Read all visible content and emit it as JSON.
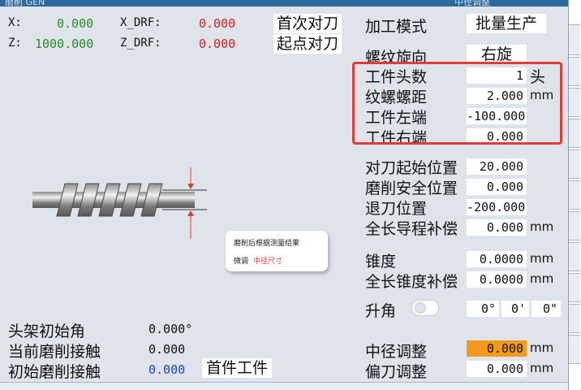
{
  "title_left": "磨削 GEN",
  "title_right": "中径调整",
  "coords": {
    "x_label": "X:",
    "x_value": "0.000",
    "z_label": "Z:",
    "z_value": "1000.000",
    "xdrf_label": "X_DRF:",
    "xdrf_value": "0.000",
    "zdrf_label": "Z_DRF:",
    "zdrf_value": "0.000"
  },
  "buttons": {
    "first_tool_set": "首次对刀",
    "start_tool_set": "起点对刀"
  },
  "machining_mode": {
    "label": "加工模式",
    "value": "批量生产"
  },
  "thread_direction": {
    "label": "螺纹旋向",
    "value": "右旋"
  },
  "workpiece": {
    "heads_label": "工件头数",
    "heads_value": "1",
    "heads_unit": "头",
    "pitch_label": "纹螺螺距",
    "pitch_value": "2.000",
    "pitch_unit": "mm",
    "left_label": "工件左端",
    "left_value": "-100.000",
    "right_label": "工件右端",
    "right_value": "0.000"
  },
  "positions": {
    "tool_start_label": "对刀起始位置",
    "tool_start_value": "20.000",
    "grind_safe_label": "磨削安全位置",
    "grind_safe_value": "0.000",
    "retract_label": "退刀位置",
    "retract_value": "-200.000",
    "lead_comp_label": "全长导程补偿",
    "lead_comp_value": "0.000",
    "lead_comp_unit": "mm"
  },
  "taper": {
    "label": "锥度",
    "value": "0.0000",
    "unit": "mm",
    "comp_label": "全长锥度补偿",
    "comp_value": "0.0000",
    "comp_unit": "mm"
  },
  "lift": {
    "label": "升角",
    "deg": "0°",
    "min": "0'",
    "sec": "0\""
  },
  "pitch_adjust": {
    "label": "中径调整",
    "value": "0.000",
    "unit": "mm"
  },
  "offset_adjust": {
    "label": "偏刀调整",
    "value": "0.000",
    "unit": "mm"
  },
  "callout": {
    "line1": "磨削后根据测量结果",
    "line2_prefix": "微调",
    "line2_highlight": "中径尺寸"
  },
  "status": {
    "head_angle_label": "头架初始角",
    "head_angle_value": "0.000°",
    "current_contact_label": "当前磨削接触",
    "current_contact_value": "0.000",
    "initial_contact_label": "初始磨削接触",
    "initial_contact_value": "0.000",
    "first_piece": "首件工件"
  },
  "colors": {
    "accent_orange": "#f39a1e",
    "highlight_red": "#e23b3b",
    "value_green": "#2c8a2c",
    "value_red": "#d42020",
    "value_blue": "#1f3fd0"
  }
}
